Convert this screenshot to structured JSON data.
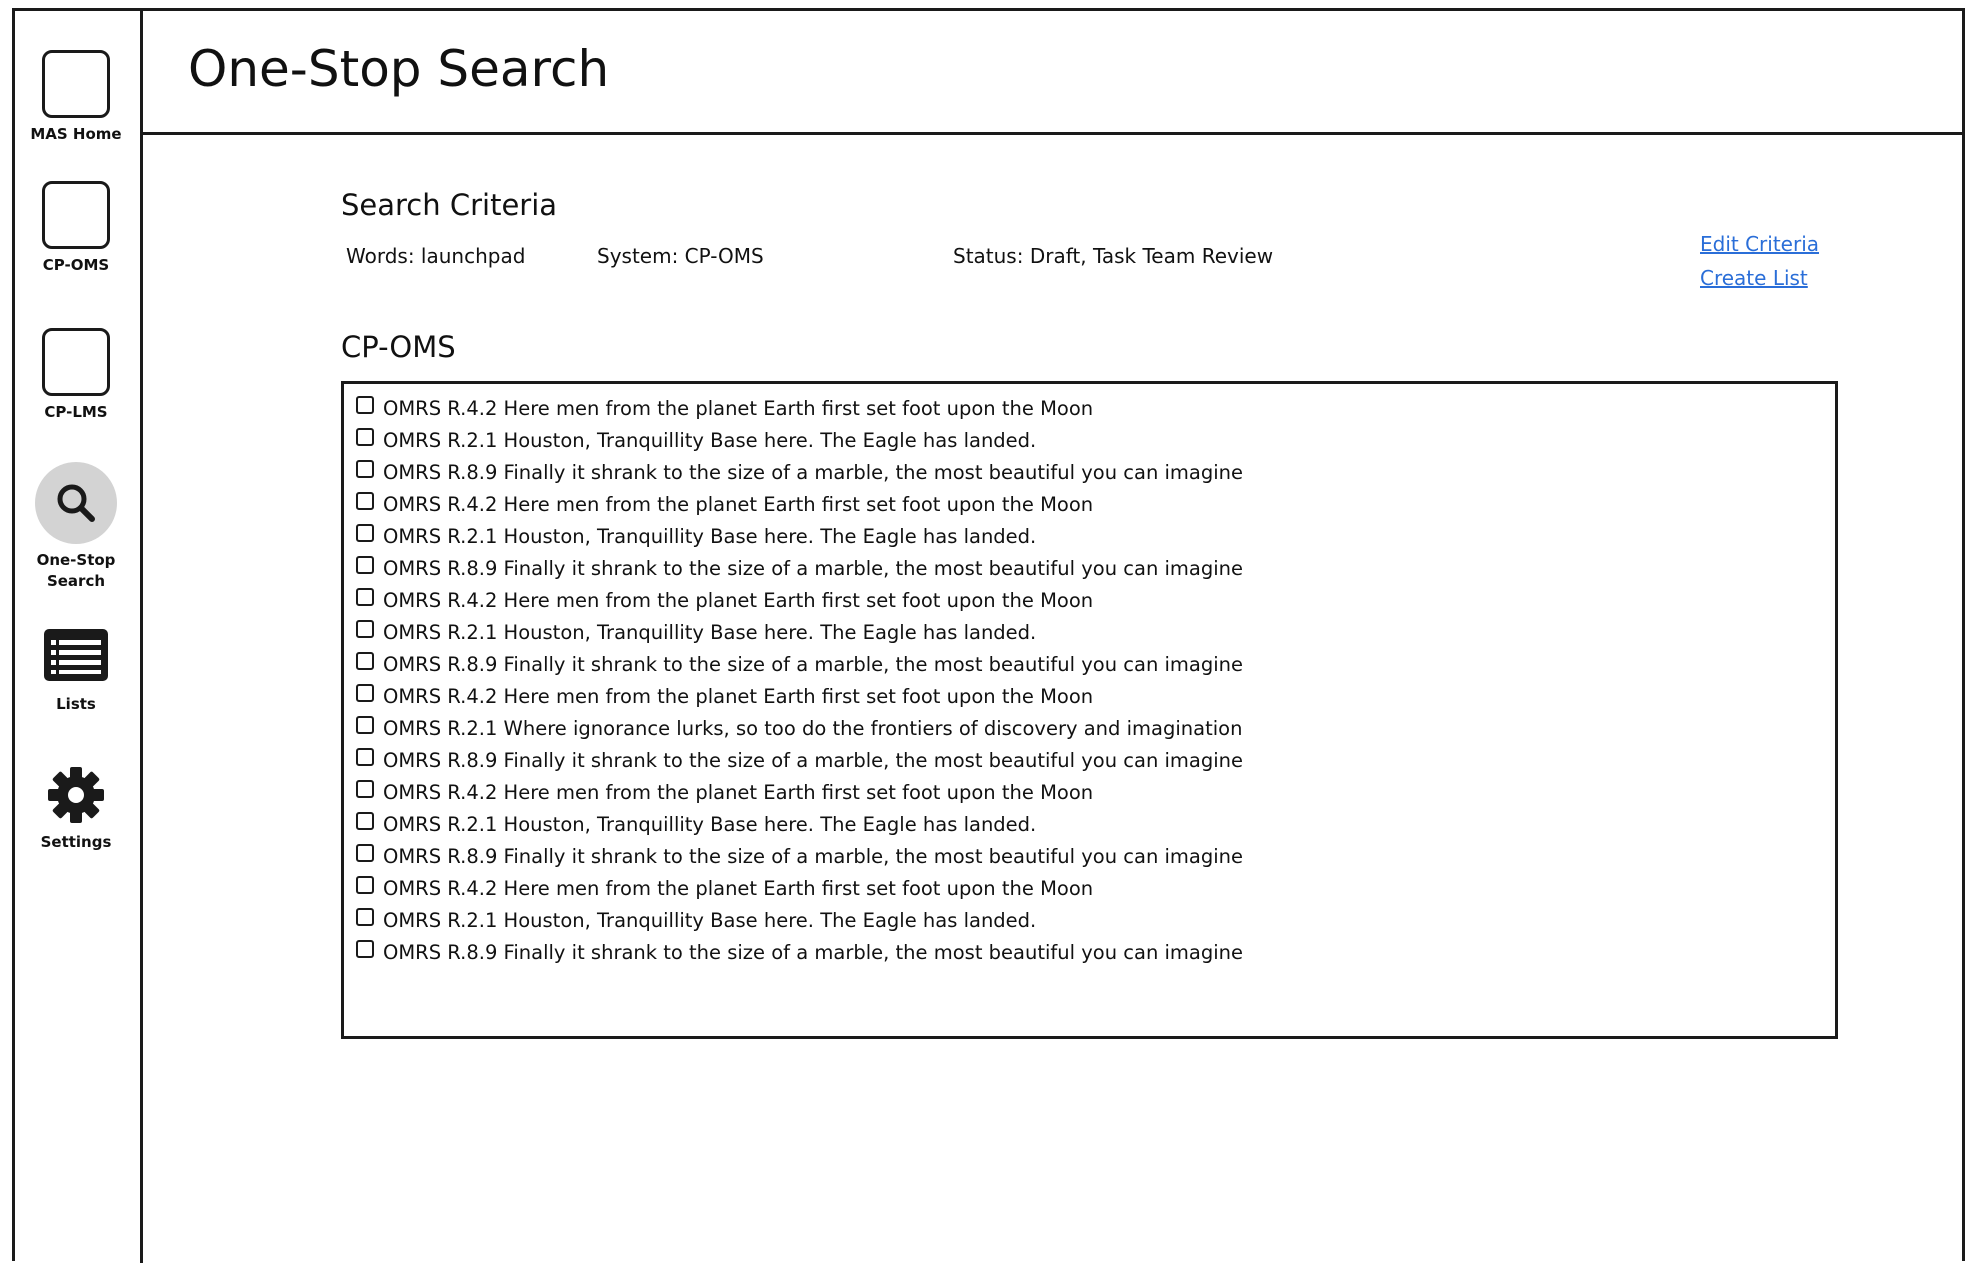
{
  "sidebar": {
    "items": [
      {
        "label": "MAS Home",
        "icon": "square-placeholder-icon"
      },
      {
        "label": "CP-OMS",
        "icon": "square-placeholder-icon"
      },
      {
        "label": "CP-LMS",
        "icon": "square-placeholder-icon"
      },
      {
        "label_line1": "One-Stop",
        "label_line2": "Search",
        "icon": "search-icon",
        "active": true
      },
      {
        "label": "Lists",
        "icon": "list-icon"
      },
      {
        "label": "Settings",
        "icon": "gear-icon"
      }
    ],
    "active_highlight_color": "#d3d3d3"
  },
  "header": {
    "title": "One-Stop Search"
  },
  "criteria": {
    "heading": "Search Criteria",
    "words": "Words: launchpad",
    "system": "System: CP-OMS",
    "status": "Status: Draft, Task Team Review",
    "edit_link": "Edit Criteria",
    "create_link": "Create List",
    "link_color": "#2a6ed8"
  },
  "results": {
    "heading": "CP-OMS",
    "items": [
      "OMRS R.4.2 Here men from the planet Earth first set foot upon the Moon",
      "OMRS R.2.1 Houston, Tranquillity Base here. The Eagle has landed.",
      "OMRS R.8.9 Finally it shrank to the size of a marble, the most beautiful you can imagine",
      "OMRS R.4.2 Here men from the planet Earth first set foot upon the Moon",
      "OMRS R.2.1 Houston, Tranquillity Base here. The Eagle has landed.",
      "OMRS R.8.9 Finally it shrank to the size of a marble, the most beautiful you can imagine",
      "OMRS R.4.2 Here men from the planet Earth first set foot upon the Moon",
      "OMRS R.2.1 Houston, Tranquillity Base here. The Eagle has landed.",
      "OMRS R.8.9 Finally it shrank to the size of a marble, the most beautiful you can imagine",
      "OMRS R.4.2 Here men from the planet Earth first set foot upon the Moon",
      "OMRS R.2.1 Where ignorance lurks, so too do the frontiers of discovery and imagination",
      "OMRS R.8.9 Finally it shrank to the size of a marble, the most beautiful you can imagine",
      "OMRS R.4.2 Here men from the planet Earth first set foot upon the Moon",
      "OMRS R.2.1 Houston, Tranquillity Base here. The Eagle has landed.",
      "OMRS R.8.9 Finally it shrank to the size of a marble, the most beautiful you can imagine",
      "OMRS R.4.2 Here men from the planet Earth first set foot upon the Moon",
      "OMRS R.2.1 Houston, Tranquillity Base here. The Eagle has landed.",
      "OMRS R.8.9 Finally it shrank to the size of a marble, the most beautiful you can imagine"
    ]
  }
}
